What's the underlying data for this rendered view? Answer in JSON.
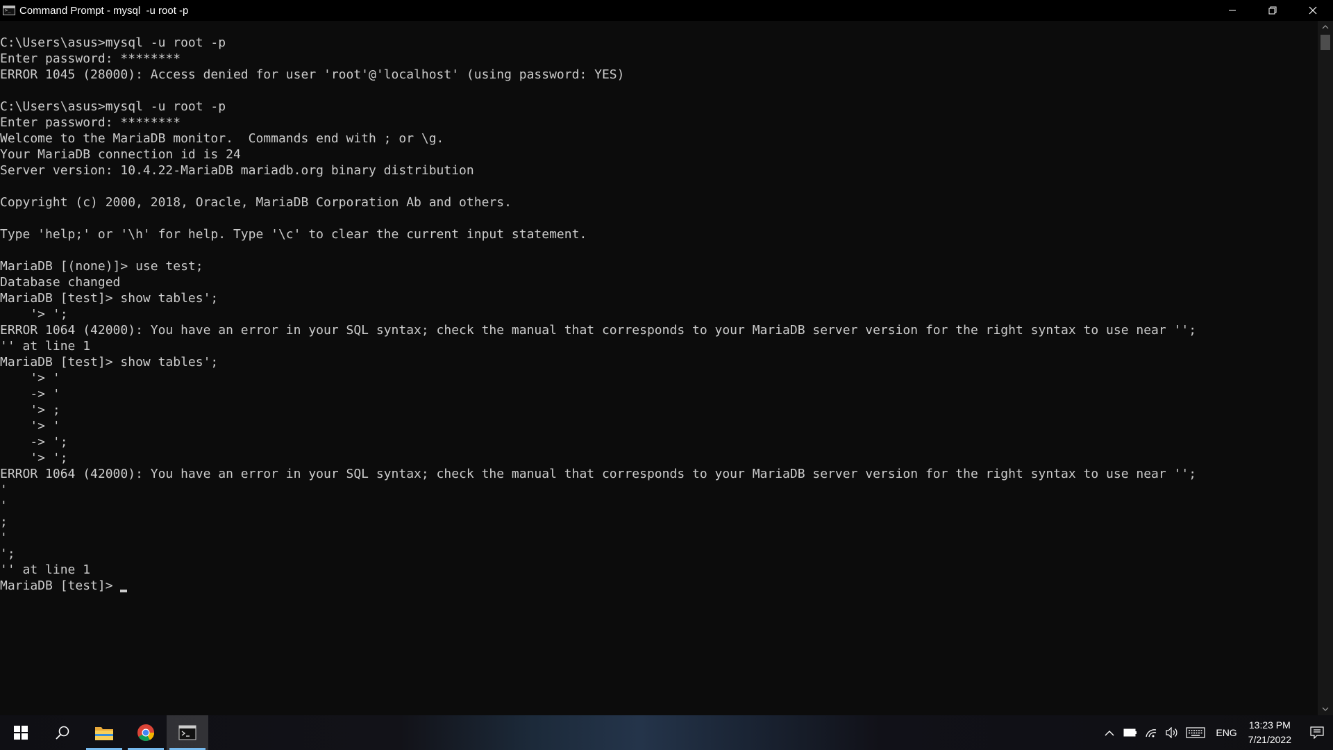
{
  "window": {
    "title": "Command Prompt - mysql  -u root -p",
    "controls": {
      "minimize": "minimize-icon",
      "maximize": "restore-icon",
      "close": "close-icon"
    }
  },
  "console": {
    "lines": "C:\\Users\\asus>mysql -u root -p\nEnter password: ********\nERROR 1045 (28000): Access denied for user 'root'@'localhost' (using password: YES)\n\nC:\\Users\\asus>mysql -u root -p\nEnter password: ********\nWelcome to the MariaDB monitor.  Commands end with ; or \\g.\nYour MariaDB connection id is 24\nServer version: 10.4.22-MariaDB mariadb.org binary distribution\n\nCopyright (c) 2000, 2018, Oracle, MariaDB Corporation Ab and others.\n\nType 'help;' or '\\h' for help. Type '\\c' to clear the current input statement.\n\nMariaDB [(none)]> use test;\nDatabase changed\nMariaDB [test]> show tables';\n    '> ';\nERROR 1064 (42000): You have an error in your SQL syntax; check the manual that corresponds to your MariaDB server version for the right syntax to use near '';\n'' at line 1\nMariaDB [test]> show tables';\n    '> '\n    -> '\n    '> ;\n    '> '\n    -> ';\n    '> ';\nERROR 1064 (42000): You have an error in your SQL syntax; check the manual that corresponds to your MariaDB server version for the right syntax to use near '';\n'\n'\n;\n'\n';\n'' at line 1",
    "prompt": "MariaDB [test]>"
  },
  "taskbar": {
    "start": "windows-start-icon",
    "search": "search-icon",
    "apps": [
      {
        "name": "file-explorer-icon",
        "running": true
      },
      {
        "name": "chrome-icon",
        "running": true
      },
      {
        "name": "command-prompt-icon",
        "running": true,
        "active": true
      }
    ],
    "tray": {
      "language": "ENG",
      "time": "13:23 PM",
      "date": "7/21/2022"
    }
  }
}
